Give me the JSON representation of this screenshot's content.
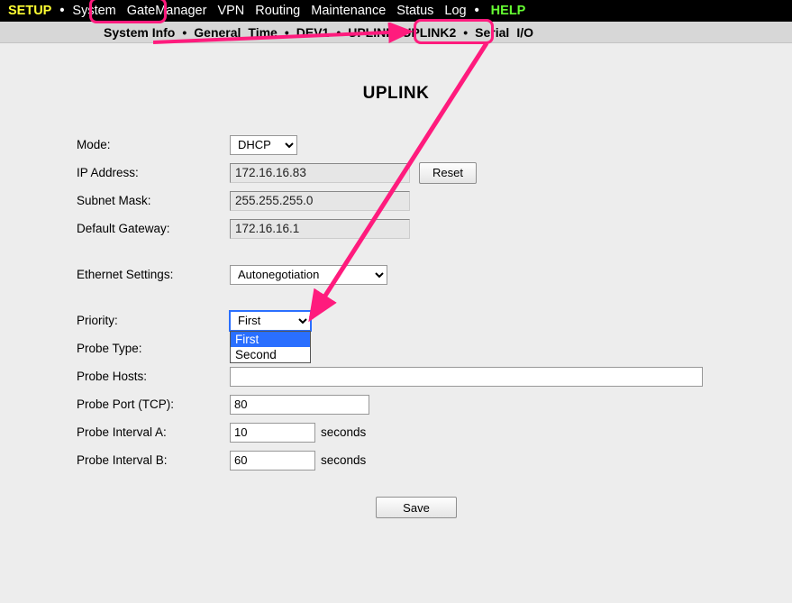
{
  "topnav": {
    "setup": "SETUP",
    "items": [
      "System",
      "GateManager",
      "VPN",
      "Routing",
      "Maintenance",
      "Status",
      "Log"
    ],
    "help": "HELP"
  },
  "subnav": {
    "items": [
      "System Info",
      "General",
      "Time",
      "DEV1",
      "UPLINK",
      "UPLINK2",
      "Serial",
      "I/O"
    ]
  },
  "page": {
    "title": "UPLINK"
  },
  "form": {
    "mode": {
      "label": "Mode:",
      "value": "DHCP"
    },
    "ip": {
      "label": "IP Address:",
      "value": "172.16.16.83",
      "reset": "Reset"
    },
    "mask": {
      "label": "Subnet Mask:",
      "value": "255.255.255.0"
    },
    "gw": {
      "label": "Default Gateway:",
      "value": "172.16.16.1"
    },
    "eth": {
      "label": "Ethernet Settings:",
      "value": "Autonegotiation"
    },
    "priority": {
      "label": "Priority:",
      "value": "First",
      "options": [
        "First",
        "Second"
      ]
    },
    "probeType": {
      "label": "Probe Type:"
    },
    "probeHosts": {
      "label": "Probe Hosts:",
      "value": ""
    },
    "probePort": {
      "label": "Probe Port (TCP):",
      "value": "80"
    },
    "probeIntA": {
      "label": "Probe Interval A:",
      "value": "10",
      "unit": "seconds"
    },
    "probeIntB": {
      "label": "Probe Interval B:",
      "value": "60",
      "unit": "seconds"
    },
    "save": "Save"
  }
}
